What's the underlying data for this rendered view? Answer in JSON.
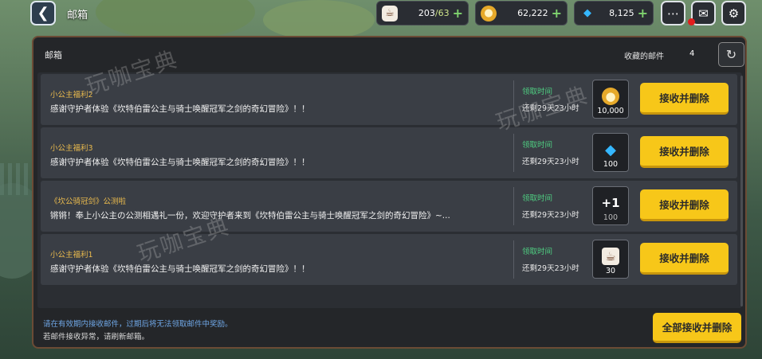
{
  "header": {
    "title": "邮箱",
    "resources": [
      {
        "icon": "coffee-cup-icon",
        "value_current": "203",
        "value_max": "/63"
      },
      {
        "icon": "gold-coin-icon",
        "value": "62,222"
      },
      {
        "icon": "diamond-gem-icon",
        "value": "8,125"
      }
    ],
    "buttons": [
      "chat-icon",
      "mail-icon",
      "gear-icon"
    ]
  },
  "mailbox": {
    "title": "邮箱",
    "favorites_label": "收藏的邮件",
    "favorites_count": "4",
    "rows": [
      {
        "title": "小公主福利2",
        "body": "感谢守护者体验《坎特伯雷公主与骑士唤醒冠军之剑的奇幻冒险》！！",
        "time_label": "领取时间",
        "time_value": "还剩29天23小时",
        "item_icon": "gold-coin-icon",
        "item_qty": "10,000",
        "action": "接收并删除"
      },
      {
        "title": "小公主福利3",
        "body": "感谢守护者体验《坎特伯雷公主与骑士唤醒冠军之剑的奇幻冒险》！！",
        "time_label": "领取时间",
        "time_value": "还剩29天23小时",
        "item_icon": "diamond-gem-icon",
        "item_qty": "100",
        "action": "接收并删除"
      },
      {
        "title": "《坎公骑冠剑》公测啦",
        "body": "锵锵！奉上小公主の公测相遇礼一份，欢迎守护者来到《坎特伯雷公主与骑士唤醒冠军之剑的奇幻冒险》~...",
        "time_label": "领取时间",
        "time_value": "还剩29天23小时",
        "item_icon": "plus-one-icon",
        "item_glyph": "+1",
        "item_qty": "100",
        "action": "接收并删除"
      },
      {
        "title": "小公主福利1",
        "body": "感谢守护者体验《坎特伯雷公主与骑士唤醒冠军之剑的奇幻冒险》！！",
        "time_label": "领取时间",
        "time_value": "还剩29天23小时",
        "item_icon": "coffee-cup-icon",
        "item_qty": "30",
        "action": "接收并删除"
      }
    ],
    "footer_line1": "请在有效期内接收邮件，过期后将无法领取邮件中奖励。",
    "footer_line2": "若邮件接收异常，请刷新邮箱。",
    "receive_all": "全部接收并删除"
  },
  "watermark": "玩咖宝典",
  "colors": {
    "accent_yellow": "#f7c719",
    "title_gold": "#e8b94d",
    "time_green": "#4fcf82",
    "hint_blue": "#6fa7e6"
  }
}
